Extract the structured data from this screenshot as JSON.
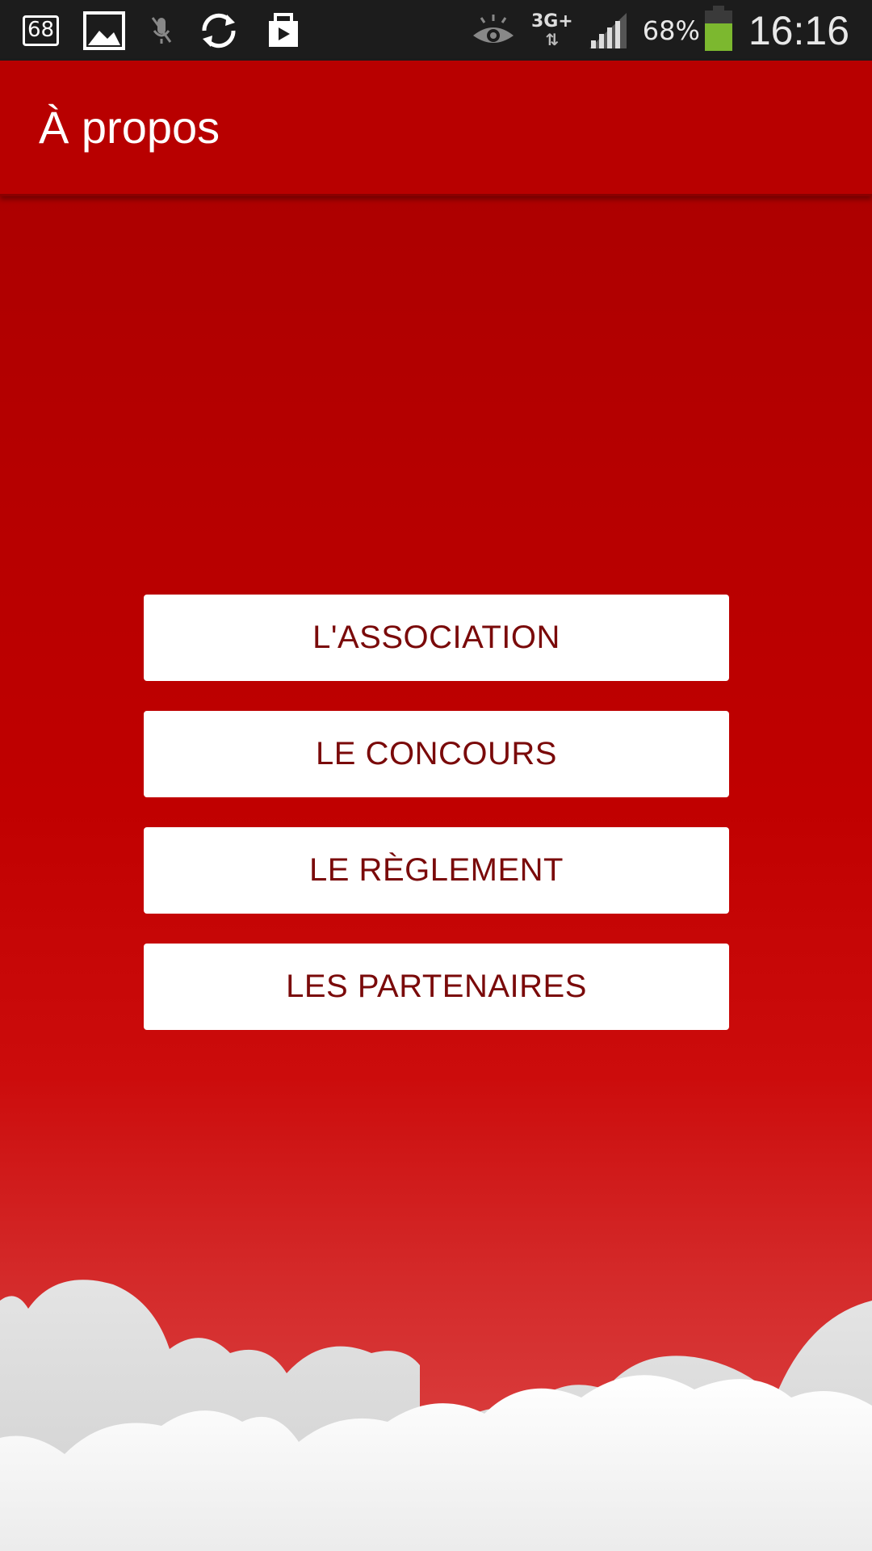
{
  "status_bar": {
    "notification_badge": "68",
    "network_type": "3G+",
    "network_arrows": "⇅",
    "battery_percent": "68%",
    "battery_level": 0.68,
    "time": "16:16"
  },
  "app_bar": {
    "title": "À propos"
  },
  "menu": {
    "buttons": [
      {
        "label": "L'ASSOCIATION"
      },
      {
        "label": "LE CONCOURS"
      },
      {
        "label": "LE RÈGLEMENT"
      },
      {
        "label": "LES PARTENAIRES"
      }
    ]
  },
  "colors": {
    "app_bar": "#b80000",
    "button_text": "#7a0a0a",
    "button_bg": "#ffffff",
    "battery": "#7cb82f"
  },
  "icons": {
    "status_left": [
      "notification-badge-icon",
      "image-icon",
      "mic-off-icon",
      "sync-icon",
      "shopping-bag-icon"
    ],
    "status_right": [
      "eye-icon",
      "signal-icon",
      "battery-icon"
    ]
  }
}
